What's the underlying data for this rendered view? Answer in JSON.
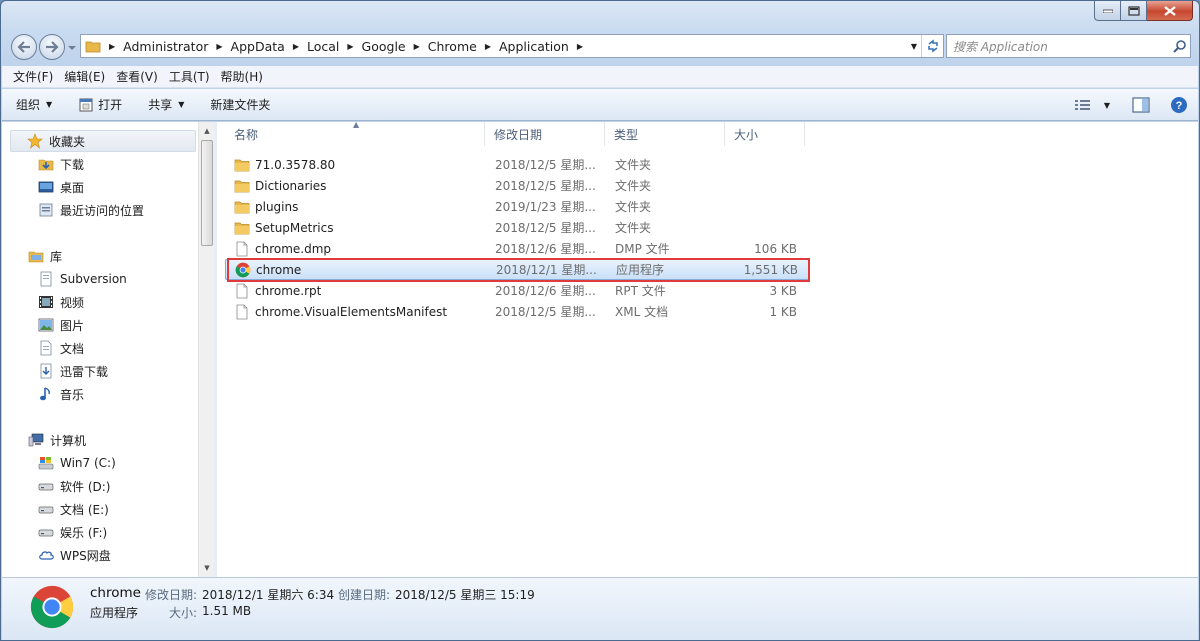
{
  "window": {
    "breadcrumb": [
      "Administrator",
      "AppData",
      "Local",
      "Google",
      "Chrome",
      "Application"
    ],
    "search_placeholder": "搜索 Application"
  },
  "menubar": {
    "items": [
      "文件(F)",
      "编辑(E)",
      "查看(V)",
      "工具(T)",
      "帮助(H)"
    ]
  },
  "toolbar": {
    "organize": "组织",
    "open": "打开",
    "share": "共享",
    "new_folder": "新建文件夹"
  },
  "nav": {
    "favorites": {
      "label": "收藏夹",
      "items": [
        "下载",
        "桌面",
        "最近访问的位置"
      ]
    },
    "libraries": {
      "label": "库",
      "items": [
        "Subversion",
        "视频",
        "图片",
        "文档",
        "迅雷下载",
        "音乐"
      ]
    },
    "computer": {
      "label": "计算机",
      "items": [
        "Win7 (C:)",
        "软件 (D:)",
        "文档 (E:)",
        "娱乐 (F:)",
        "WPS网盘"
      ]
    }
  },
  "columns": {
    "name": "名称",
    "modified": "修改日期",
    "type": "类型",
    "size": "大小"
  },
  "files": [
    {
      "name": "71.0.3578.80",
      "modified": "2018/12/5 星期...",
      "type": "文件夹",
      "size": "",
      "icon": "folder-icon"
    },
    {
      "name": "Dictionaries",
      "modified": "2018/12/5 星期...",
      "type": "文件夹",
      "size": "",
      "icon": "folder-icon"
    },
    {
      "name": "plugins",
      "modified": "2019/1/23 星期...",
      "type": "文件夹",
      "size": "",
      "icon": "folder-icon"
    },
    {
      "name": "SetupMetrics",
      "modified": "2018/12/5 星期...",
      "type": "文件夹",
      "size": "",
      "icon": "folder-icon"
    },
    {
      "name": "chrome.dmp",
      "modified": "2018/12/6 星期...",
      "type": "DMP 文件",
      "size": "106 KB",
      "icon": "file-icon"
    },
    {
      "name": "chrome",
      "modified": "2018/12/1 星期...",
      "type": "应用程序",
      "size": "1,551 KB",
      "icon": "chrome-icon"
    },
    {
      "name": "chrome.rpt",
      "modified": "2018/12/6 星期...",
      "type": "RPT 文件",
      "size": "3 KB",
      "icon": "file-icon"
    },
    {
      "name": "chrome.VisualElementsManifest",
      "modified": "2018/12/5 星期...",
      "type": "XML 文档",
      "size": "1 KB",
      "icon": "file-icon"
    }
  ],
  "selected_index": 5,
  "details": {
    "name": "chrome",
    "type": "应用程序",
    "modified_label": "修改日期:",
    "modified_value": "2018/12/1 星期六 6:34",
    "created_label": "创建日期:",
    "created_value": "2018/12/5 星期三 15:19",
    "size_label": "大小:",
    "size_value": "1.51 MB"
  },
  "colors": {
    "highlight": "#e03a3a",
    "selection": "#c9e0f8",
    "folder": "#e8b84a"
  }
}
